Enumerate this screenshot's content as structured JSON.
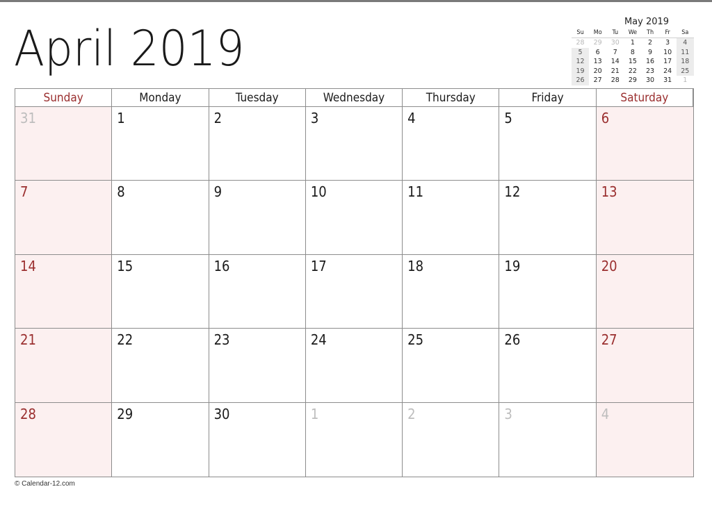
{
  "title": "April 2019",
  "colors": {
    "weekend_text": "#9a2e2e",
    "weekend_bg": "#fcf0f0",
    "other_month_text": "#bdbdbd",
    "grid_line": "#8c8c8c",
    "mini_weekend_bg": "#ececec"
  },
  "weekdays": [
    "Sunday",
    "Monday",
    "Tuesday",
    "Wednesday",
    "Thursday",
    "Friday",
    "Saturday"
  ],
  "weeks": [
    [
      {
        "d": "31",
        "other": true
      },
      {
        "d": "1"
      },
      {
        "d": "2"
      },
      {
        "d": "3"
      },
      {
        "d": "4"
      },
      {
        "d": "5"
      },
      {
        "d": "6"
      }
    ],
    [
      {
        "d": "7"
      },
      {
        "d": "8"
      },
      {
        "d": "9"
      },
      {
        "d": "10"
      },
      {
        "d": "11"
      },
      {
        "d": "12"
      },
      {
        "d": "13"
      }
    ],
    [
      {
        "d": "14"
      },
      {
        "d": "15"
      },
      {
        "d": "16"
      },
      {
        "d": "17"
      },
      {
        "d": "18"
      },
      {
        "d": "19"
      },
      {
        "d": "20"
      }
    ],
    [
      {
        "d": "21"
      },
      {
        "d": "22"
      },
      {
        "d": "23"
      },
      {
        "d": "24"
      },
      {
        "d": "25"
      },
      {
        "d": "26"
      },
      {
        "d": "27"
      }
    ],
    [
      {
        "d": "28"
      },
      {
        "d": "29"
      },
      {
        "d": "30"
      },
      {
        "d": "1",
        "other": true
      },
      {
        "d": "2",
        "other": true
      },
      {
        "d": "3",
        "other": true
      },
      {
        "d": "4",
        "other": true
      }
    ]
  ],
  "mini_calendar": {
    "title": "May 2019",
    "weekdays": [
      "Su",
      "Mo",
      "Tu",
      "We",
      "Th",
      "Fr",
      "Sa"
    ],
    "weeks": [
      [
        {
          "d": "28",
          "other": true
        },
        {
          "d": "29",
          "other": true
        },
        {
          "d": "30",
          "other": true
        },
        {
          "d": "1"
        },
        {
          "d": "2"
        },
        {
          "d": "3"
        },
        {
          "d": "4"
        }
      ],
      [
        {
          "d": "5"
        },
        {
          "d": "6"
        },
        {
          "d": "7"
        },
        {
          "d": "8"
        },
        {
          "d": "9"
        },
        {
          "d": "10"
        },
        {
          "d": "11"
        }
      ],
      [
        {
          "d": "12"
        },
        {
          "d": "13"
        },
        {
          "d": "14"
        },
        {
          "d": "15"
        },
        {
          "d": "16"
        },
        {
          "d": "17"
        },
        {
          "d": "18"
        }
      ],
      [
        {
          "d": "19"
        },
        {
          "d": "20"
        },
        {
          "d": "21"
        },
        {
          "d": "22"
        },
        {
          "d": "23"
        },
        {
          "d": "24"
        },
        {
          "d": "25"
        }
      ],
      [
        {
          "d": "26"
        },
        {
          "d": "27"
        },
        {
          "d": "28"
        },
        {
          "d": "29"
        },
        {
          "d": "30"
        },
        {
          "d": "31"
        },
        {
          "d": "1",
          "other": true
        }
      ]
    ]
  },
  "footer": "© Calendar-12.com"
}
